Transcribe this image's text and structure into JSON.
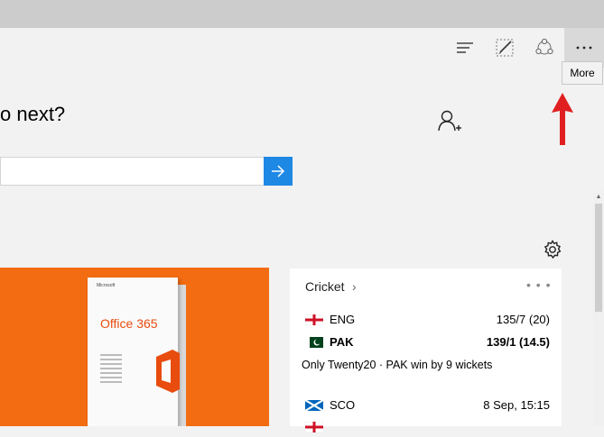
{
  "toolbar": {
    "hub_icon": "hub-icon",
    "note_icon": "web-note-icon",
    "share_icon": "share-icon",
    "more_icon": "more-dots-icon",
    "more_tooltip": "More"
  },
  "main": {
    "heading": "o next?",
    "search_placeholder": "",
    "gear_icon": "gear-icon",
    "add_user_icon": "add-user-icon"
  },
  "promo": {
    "product_logo": "Microsoft",
    "product_title": "Office 365",
    "colors": {
      "background": "#f36c12",
      "title": "#e84c0e"
    }
  },
  "cricket": {
    "title": "Cricket",
    "chevron": "›",
    "more": "• • •",
    "matches": [
      {
        "teams": [
          {
            "name": "ENG",
            "score": "135/7 (20)",
            "bold": false
          },
          {
            "name": "PAK",
            "score": "139/1 (14.5)",
            "bold": true
          }
        ],
        "result": "Only Twenty20 · PAK win by 9 wickets"
      },
      {
        "teams": [
          {
            "name": "SCO",
            "score": "8 Sep, 15:15",
            "bold": false
          }
        ]
      }
    ]
  },
  "colors": {
    "accent": "#1e88e5",
    "arrow": "#e02020",
    "titlebar": "#cccccc"
  }
}
